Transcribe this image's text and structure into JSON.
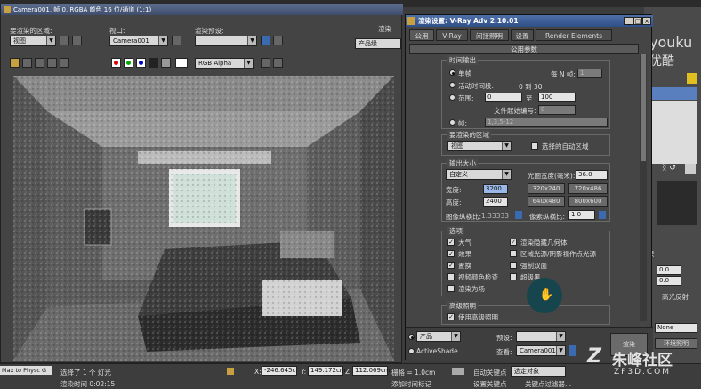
{
  "fb": {
    "title": "Camera001, 帧 0, RGBA 颜色 16 位/通道 (1:1)",
    "area_label": "要渲染的区域:",
    "area_value": "视图",
    "viewport_label": "视口:",
    "viewport_value": "Camera001",
    "preset_label": "渲染预设:",
    "preset_value": "",
    "render_btn": "渲染",
    "product_value": "产品级",
    "channel_value": "RGB Alpha"
  },
  "rs": {
    "title": "渲染设置: V-Ray Adv 2.10.01",
    "tabs": [
      "公用",
      "V-Ray",
      "间接照明",
      "设置",
      "Render Elements"
    ],
    "rollout": "公用参数",
    "time_output": {
      "title": "时间输出",
      "single": "单帧",
      "every_n": "每 N 帧:",
      "every_n_val": "1",
      "active_seg": "活动时间段:",
      "active_seg_val": "0 到 30",
      "range": "范围:",
      "range_from": "0",
      "range_to_label": "至",
      "range_to": "100",
      "file_num": "文件起始编号:",
      "file_num_val": "0",
      "frames": "帧:",
      "frames_val": "1,3,5-12"
    },
    "area": {
      "title": "要渲染的区域",
      "value": "视图",
      "auto_region": "选择的自动区域"
    },
    "output_size": {
      "title": "输出大小",
      "preset": "自定义",
      "aperture": "光圈宽度(毫米):",
      "aperture_val": "36.0",
      "width_label": "宽度:",
      "width_val": "3200",
      "height_label": "高度:",
      "height_val": "2400",
      "p1": "320x240",
      "p2": "720x486",
      "p3": "640x480",
      "p4": "800x600",
      "aspect_label": "图像纵横比:",
      "aspect_val": "1.33333",
      "pixel_aspect_label": "像素纵横比:",
      "pixel_aspect_val": "1.0"
    },
    "options": {
      "title": "选项",
      "atmos": "大气",
      "render_hidden": "渲染隐藏几何体",
      "effects": "效果",
      "area_lights": "区域光源/阴影视作点光源",
      "displace": "置换",
      "force2side": "强制双面",
      "video_check": "视频颜色检查",
      "superblack": "超级黑",
      "render_fields": "渲染为场"
    },
    "adv_light": {
      "title": "高级照明",
      "use": "使用高级照明"
    },
    "bottom": {
      "product": "产品",
      "activeshade": "ActiveShade",
      "preset_label": "预设:",
      "preset_val": "",
      "view_label": "查看:",
      "view_val": "Camera001",
      "render_btn": "渲染"
    }
  },
  "right": {
    "watermark1": "youku",
    "watermark2": "优酷",
    "txt1": "果",
    "val1": "0.0",
    "val2": "0.0",
    "highlight": "高光反射",
    "none": "None",
    "env_light": "环境照明"
  },
  "status": {
    "left1": "Max to Physc G",
    "msg": "选择了 1 个 灯光",
    "x_label": "X:",
    "x_val": "-246.645c",
    "y_label": "Y:",
    "y_val": "149.172cm",
    "z_label": "Z:",
    "z_val": "112.069cm",
    "grid": "栅格 = 1.0cm",
    "autokey": "自动关键点",
    "sel_obj": "选定对象",
    "setkey": "设置关键点",
    "keyfilter": "关键点过滤器...",
    "add_time": "添加时间标记",
    "render_time": "渲染时间 0:02:15"
  },
  "watermark": {
    "brand": "朱峰社区",
    "site": "ZF3D.COM"
  }
}
